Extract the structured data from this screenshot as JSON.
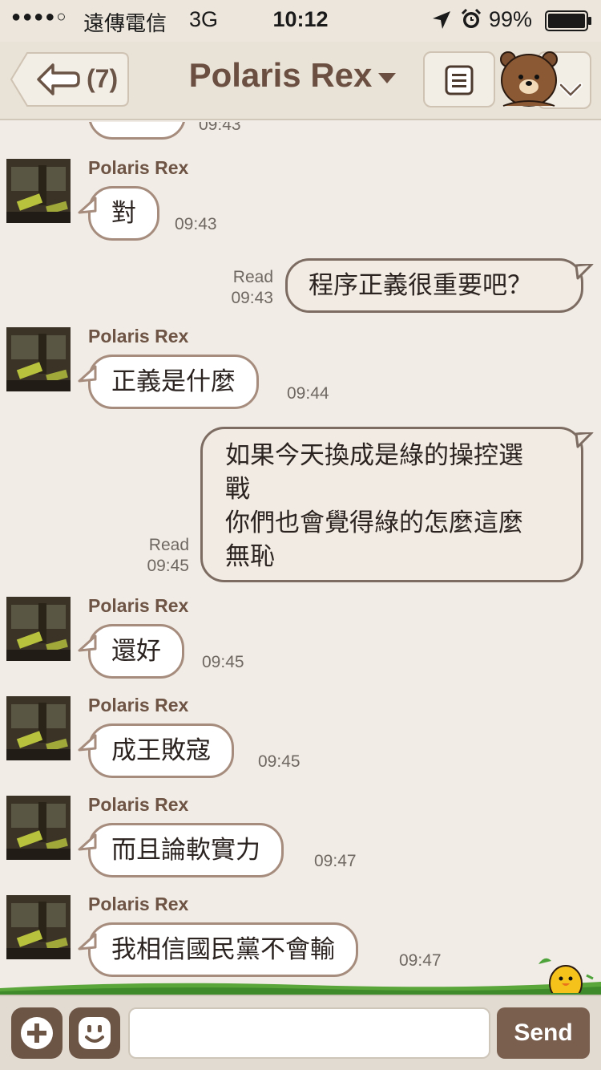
{
  "status_bar": {
    "signal": "●●●●○",
    "carrier": "遠傳電信",
    "network": "3G",
    "time": "10:12",
    "battery": "99%"
  },
  "nav": {
    "back_count": "(7)",
    "title": "Polaris Rex"
  },
  "messages": [
    {
      "sender": "Polaris Rex",
      "text": "對",
      "time": "09:43"
    },
    {
      "read": "Read",
      "time": "09:43",
      "text": "程序正義很重要吧？"
    },
    {
      "sender": "Polaris Rex",
      "text": "正義是什麼",
      "time": "09:44"
    },
    {
      "read": "Read",
      "time": "09:45",
      "lines": [
        "如果今天換成是綠的操控選",
        "戰",
        "你們也會覺得綠的怎麼這麼",
        "無恥"
      ]
    },
    {
      "sender": "Polaris Rex",
      "text": "還好",
      "time": "09:45"
    },
    {
      "sender": "Polaris Rex",
      "text": "成王敗寇",
      "time": "09:45"
    },
    {
      "sender": "Polaris Rex",
      "text": "而且論軟實力",
      "time": "09:47"
    },
    {
      "sender": "Polaris Rex",
      "text": "我相信國民黨不會輸",
      "time": "09:47"
    }
  ],
  "partial_time": "09:43",
  "input": {
    "placeholder": "",
    "send_label": "Send"
  }
}
